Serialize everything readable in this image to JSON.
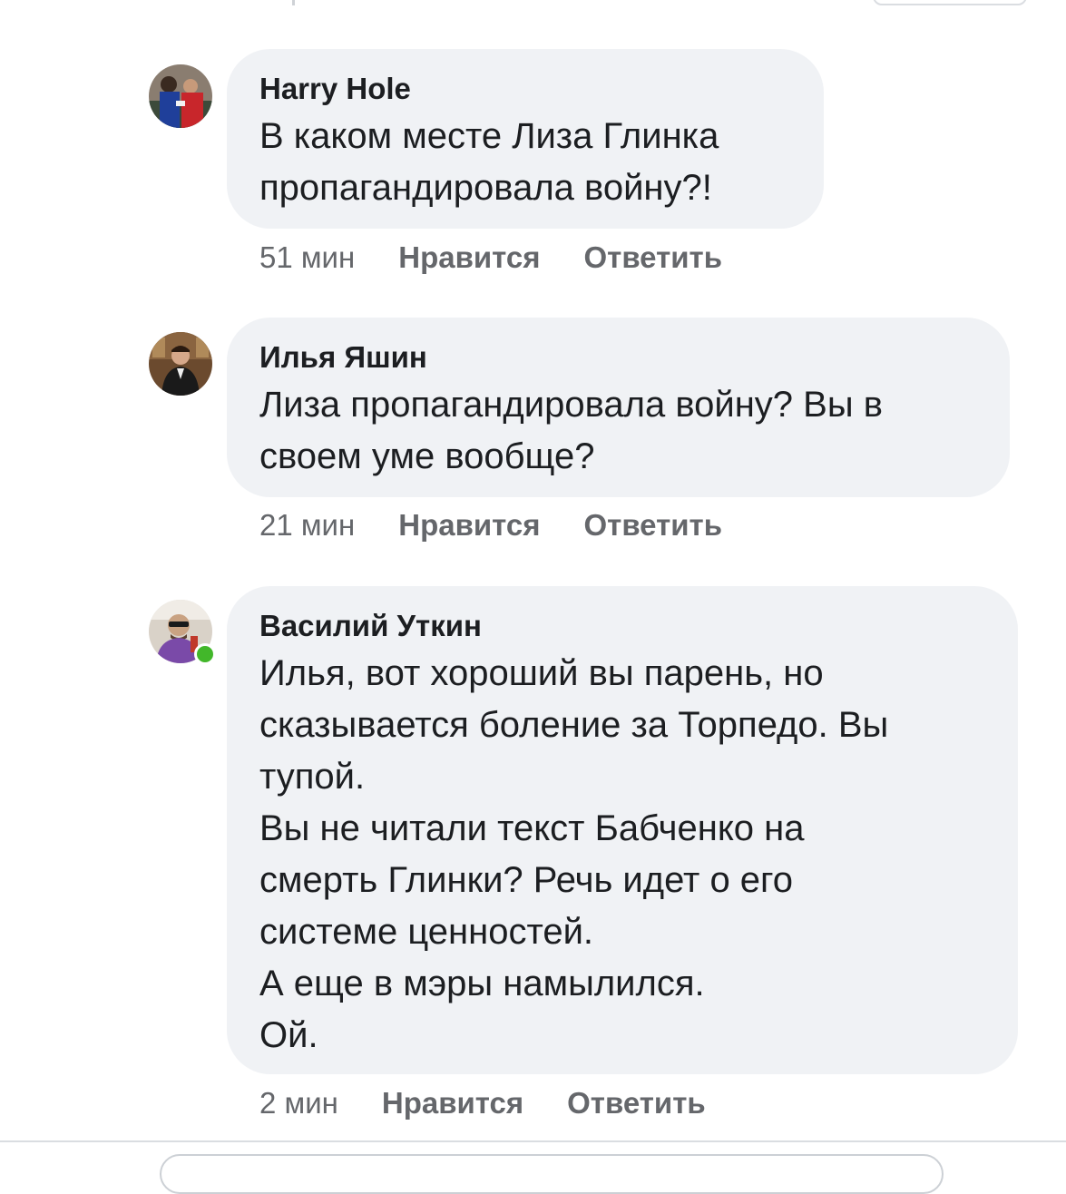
{
  "comments": [
    {
      "author": "Harry Hole",
      "text": "В каком месте Лиза Глинка\nпропагандировала войну?!",
      "time": "51 мин",
      "like_label": "Нравится",
      "reply_label": "Ответить",
      "avatar_icon": "avatar-harry-hole"
    },
    {
      "author": "Илья Яшин",
      "text": "Лиза пропагандировала войну? Вы в\nсвоем уме вообще?",
      "time": "21 мин",
      "like_label": "Нравится",
      "reply_label": "Ответить",
      "avatar_icon": "avatar-ilya-yashin"
    },
    {
      "author": "Василий Уткин",
      "text": "Илья, вот хороший вы парень, но\nсказывается боление за Торпедо. Вы\nтупой.\nВы не читали текст Бабченко на\nсмерть Глинки? Речь идет о его\nсистеме ценностей.\nА еще в мэры намылился.\nОй.",
      "time": "2 мин",
      "like_label": "Нравится",
      "reply_label": "Ответить",
      "avatar_icon": "avatar-vasily-utkin",
      "online": true
    }
  ],
  "colors": {
    "bubble_bg": "#f0f2f5",
    "meta_text": "#65676b",
    "online": "#42b72a"
  }
}
